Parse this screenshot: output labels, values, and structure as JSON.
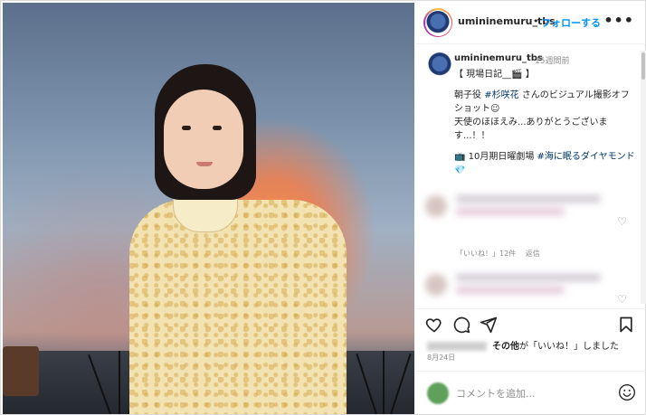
{
  "post": {
    "username": "umininemuru_tbs",
    "separator": "•",
    "follow_label": "フォローする",
    "more_label": "•••"
  },
  "caption": {
    "username": "umininemuru_tbs",
    "time": "15週間前",
    "title": "【 現場日記__🎬 】",
    "line1_prefix": "朝子役 ",
    "line1_tag": "#杉咲花",
    "line1_suffix": " さんのビジュアル撮影オフショット☺︎",
    "line2": "天使のほほえみ...ありがとうございます...！！",
    "line3_prefix": "📺 10月期日曜劇場 ",
    "line3_tag": "#海に眠るダイヤモンド",
    "line3_suffix": " 💎"
  },
  "comments_meta": {
    "likes": "「いいね！」12件",
    "reply": "返信"
  },
  "likes_line": {
    "others": "その他",
    "text": "が「いいね！」しました"
  },
  "date": "8月24日",
  "comment_box": {
    "placeholder": "コメントを追加..."
  },
  "icons": [
    "more-icon",
    "heart-icon",
    "comment-icon",
    "share-icon",
    "save-icon",
    "emoji-icon"
  ]
}
